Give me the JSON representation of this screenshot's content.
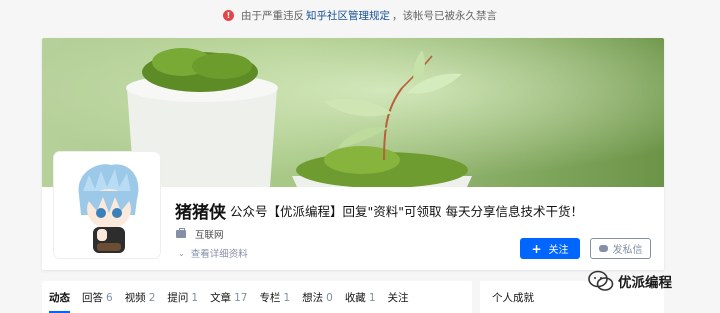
{
  "notice": {
    "prefix": "由于严重违反",
    "link": "知乎社区管理规定",
    "suffix": "，该帐号已被永久禁言"
  },
  "profile": {
    "name": "猪猪侠",
    "headline": "公众号【优派编程】回复\"资料\"可领取 每天分享信息技术干货！",
    "industry": "互联网",
    "more_info": "查看详细资料",
    "follow_label": "关注",
    "message_label": "发私信"
  },
  "tabs": [
    {
      "label": "动态",
      "count": ""
    },
    {
      "label": "回答",
      "count": "6"
    },
    {
      "label": "视频",
      "count": "2"
    },
    {
      "label": "提问",
      "count": "1"
    },
    {
      "label": "文章",
      "count": "17"
    },
    {
      "label": "专栏",
      "count": "1"
    },
    {
      "label": "想法",
      "count": "0"
    },
    {
      "label": "收藏",
      "count": "1"
    },
    {
      "label": "关注",
      "count": ""
    }
  ],
  "side": {
    "title": "个人成就"
  },
  "watermark": {
    "text": "优派编程"
  },
  "colors": {
    "accent": "#0066ff",
    "warning": "#e2464a",
    "link": "#175199",
    "muted": "#8590a6"
  }
}
